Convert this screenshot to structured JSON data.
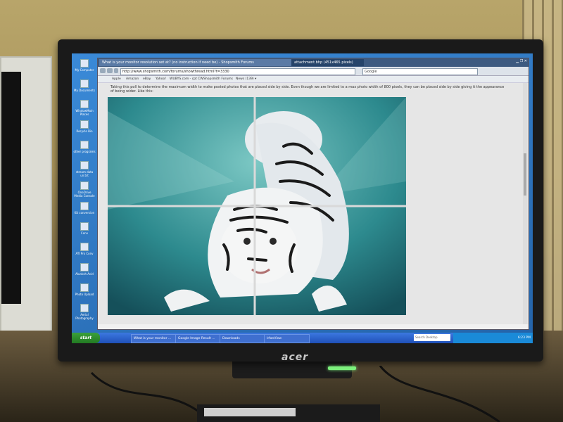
{
  "browser": {
    "tabs": [
      "What is your monitor resolution set at? (no instruction if need be) - Shopsmith Forums",
      "attachment.bhp (451x465 pixels)"
    ],
    "url": "http://www.shopsmith.com/forums/showthread.html?t=3330",
    "search_placeholder": "Google",
    "bookmarks": [
      "Apple",
      "Amazon",
      "eBay",
      "Yahoo!",
      "WUBYS.com - cpt CW",
      "Shopsmith Forums",
      "News (139) ▾"
    ],
    "page_text": "Taking this poll to determine the maximum width to make posted photos that are placed side by side. Even though we are limited to a max photo width of 800 pixels, they can be placed side by side giving it the appearance of being wider. Like this:"
  },
  "desktop_icons": [
    "My Computer",
    "My Documents",
    "WindowMain Places",
    "Recycle Bin",
    "other programs",
    "stream data un.tst",
    "OneDrive Media Console",
    "Kit conversion",
    "Conv",
    "ATI Pro Conv",
    "Alunksh Acid",
    "Photo Upload",
    "Aerial Photography"
  ],
  "taskbar": {
    "start": "start",
    "tasks": [
      "What is your monitor ...",
      "Google Image Result ...",
      "Downloads",
      "IrfanView"
    ],
    "search": "Search Desktop",
    "clock": "6:23 PM"
  },
  "monitor": {
    "brand": "acer"
  }
}
